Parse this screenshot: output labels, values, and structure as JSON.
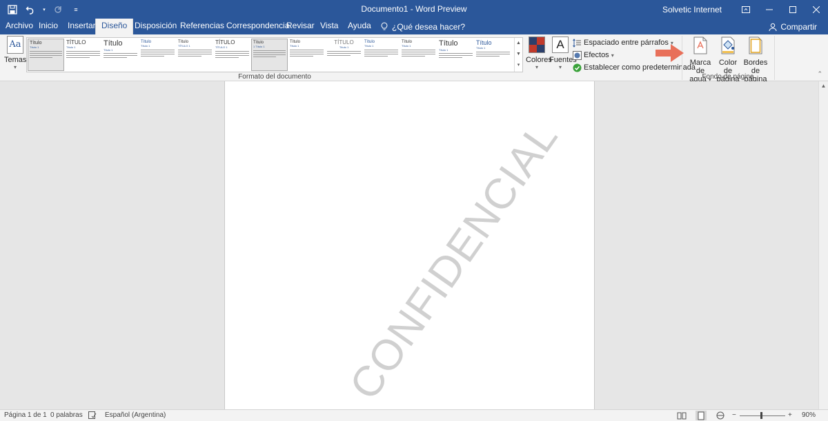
{
  "window": {
    "title": "Documento1  -  Word Preview",
    "user": "Solvetic Internet"
  },
  "tabs": [
    {
      "label": "Archivo"
    },
    {
      "label": "Inicio"
    },
    {
      "label": "Insertar"
    },
    {
      "label": "Diseño"
    },
    {
      "label": "Disposición"
    },
    {
      "label": "Referencias"
    },
    {
      "label": "Correspondencia"
    },
    {
      "label": "Revisar"
    },
    {
      "label": "Vista"
    },
    {
      "label": "Ayuda"
    }
  ],
  "active_tab": "Diseño",
  "tell_me": "¿Qué desea hacer?",
  "share": "Compartir",
  "ribbon": {
    "themes_label": "Temas",
    "gallery": [
      {
        "title": "Título",
        "heading": "Título 1"
      },
      {
        "title": "TÍTULO",
        "heading": "Título 1"
      },
      {
        "title": "Título",
        "heading": "Título 1"
      },
      {
        "title": "Título",
        "heading": "Título 1"
      },
      {
        "title": "Título",
        "heading": "TÍTULO 1"
      },
      {
        "title": "TÍTULO",
        "heading": "TÍTULO 1"
      },
      {
        "title": "Título",
        "heading": "1  Título 1"
      },
      {
        "title": "Título",
        "heading": "Título 1"
      },
      {
        "title": "TÍTULO",
        "heading": "Título 1"
      },
      {
        "title": "Título",
        "heading": "Título 1"
      },
      {
        "title": "Título",
        "heading": "Título 1"
      },
      {
        "title": "Título",
        "heading": "Título 1"
      },
      {
        "title": "Título",
        "heading": "Título 1"
      }
    ],
    "document_format_label": "Formato del documento",
    "colors_label": "Colores",
    "fonts_label": "Fuentes",
    "paragraph_spacing_label": "Espaciado entre párrafos",
    "effects_label": "Efectos",
    "set_default_label": "Establecer como predeterminada",
    "watermark_label_1": "Marca de",
    "watermark_label_2": "agua",
    "page_color_label_1": "Color de",
    "page_color_label_2": "página",
    "page_borders_label_1": "Bordes",
    "page_borders_label_2": "de página",
    "page_background_label": "Fondo de página"
  },
  "document": {
    "watermark_text": "CONFIDENCIAL"
  },
  "status": {
    "page": "Página 1 de 1",
    "words": "0 palabras",
    "language": "Español (Argentina)",
    "zoom": "90%"
  },
  "colors": {
    "accent": "#2b579a",
    "arrow": "#e8705a"
  }
}
